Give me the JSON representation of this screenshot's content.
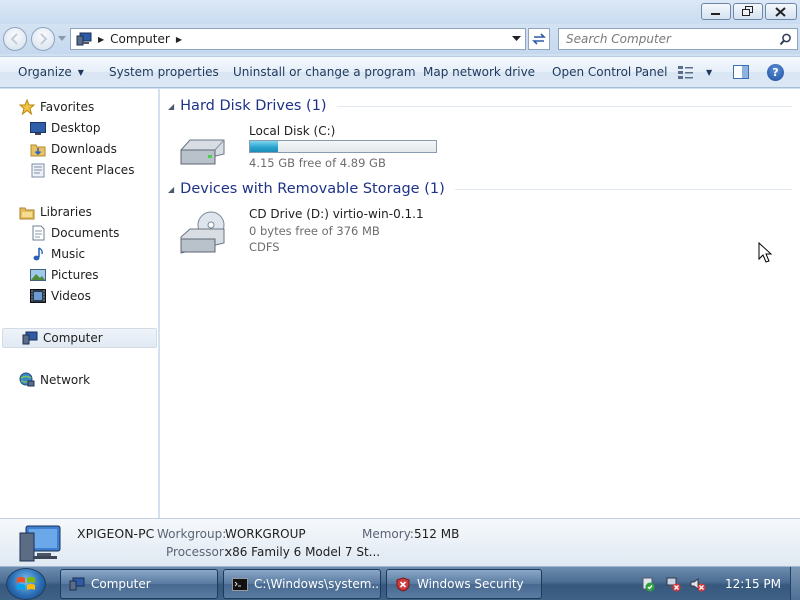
{
  "window": {
    "address": {
      "crumbs": [
        "Computer"
      ]
    },
    "search": {
      "placeholder": "Search Computer"
    }
  },
  "toolbar": {
    "organize": "Organize",
    "system_properties": "System properties",
    "uninstall": "Uninstall or change a program",
    "map_drive": "Map network drive",
    "control_panel": "Open Control Panel",
    "help": "?"
  },
  "sidebar": {
    "favorites": "Favorites",
    "favorites_items": [
      "Desktop",
      "Downloads",
      "Recent Places"
    ],
    "libraries": "Libraries",
    "libraries_items": [
      "Documents",
      "Music",
      "Pictures",
      "Videos"
    ],
    "computer": "Computer",
    "network": "Network"
  },
  "groups": {
    "hdd": {
      "title": "Hard Disk Drives (1)",
      "drive": {
        "name": "Local Disk (C:)",
        "free": "4.15 GB free of 4.89 GB",
        "used_fraction": 0.15
      }
    },
    "removable": {
      "title": "Devices with Removable Storage (1)",
      "drive": {
        "name": "CD Drive (D:) virtio-win-0.1.1",
        "free": "0 bytes free of 376 MB",
        "fs": "CDFS"
      }
    }
  },
  "details": {
    "pc_name": "XPIGEON-PC",
    "workgroup_label": "Workgroup:",
    "workgroup_value": "WORKGROUP",
    "memory_label": "Memory:",
    "memory_value": "512 MB",
    "processor_label": "Processor:",
    "processor_value": "x86 Family 6 Model 7 St..."
  },
  "taskbar": {
    "tasks": [
      "Computer",
      "C:\\Windows\\system...",
      "Windows Security"
    ],
    "clock": "12:15 PM"
  },
  "colors": {
    "accent": "#1e3287",
    "usage_fill": "#2aa4cf",
    "taskbar": "#4b6d92"
  }
}
